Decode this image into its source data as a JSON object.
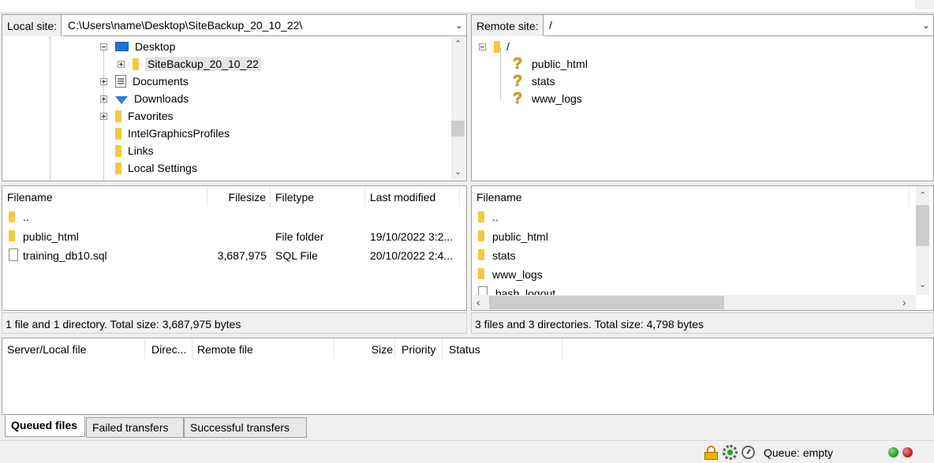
{
  "local": {
    "site_label": "Local site:",
    "path": "C:\\Users\\name\\Desktop\\SiteBackup_20_10_22\\",
    "tree": [
      "Desktop",
      "SiteBackup_20_10_22",
      "Documents",
      "Downloads",
      "Favorites",
      "IntelGraphicsProfiles",
      "Links",
      "Local Settings"
    ],
    "columns": [
      "Filename",
      "Filesize",
      "Filetype",
      "Last modified"
    ],
    "files": [
      {
        "name": "..",
        "size": "",
        "type": "",
        "modified": ""
      },
      {
        "name": "public_html",
        "size": "",
        "type": "File folder",
        "modified": "19/10/2022 3:2..."
      },
      {
        "name": "training_db10.sql",
        "size": "3,687,975",
        "type": "SQL File",
        "modified": "20/10/2022 2:4..."
      }
    ],
    "status": "1 file and 1 directory. Total size: 3,687,975 bytes"
  },
  "remote": {
    "site_label": "Remote site:",
    "path": "/",
    "tree_root": "/",
    "tree": [
      "public_html",
      "stats",
      "www_logs"
    ],
    "columns": [
      "Filename"
    ],
    "files": [
      "..",
      "public_html",
      "stats",
      "www_logs",
      ".bash_logout"
    ],
    "status": "3 files and 3 directories. Total size: 4,798 bytes"
  },
  "queue": {
    "columns": [
      "Server/Local file",
      "Direc...",
      "Remote file",
      "Size",
      "Priority",
      "Status"
    ],
    "tabs": [
      "Queued files",
      "Failed transfers",
      "Successful transfers"
    ],
    "status_text": "Queue: empty"
  },
  "colors": {
    "folder": "#f5c842",
    "led_green": "#2f9e2f",
    "led_red": "#b8282b"
  }
}
